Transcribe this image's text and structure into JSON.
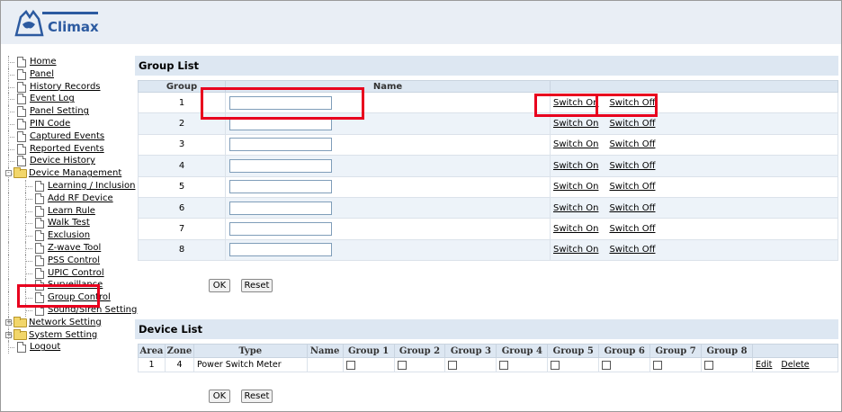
{
  "brand": {
    "logo_text": "Climax"
  },
  "sidebar": {
    "items": [
      {
        "label": "Home",
        "level": 0,
        "icon": "doc"
      },
      {
        "label": "Panel",
        "level": 0,
        "icon": "doc"
      },
      {
        "label": "History Records",
        "level": 0,
        "icon": "doc"
      },
      {
        "label": "Event Log",
        "level": 0,
        "icon": "doc"
      },
      {
        "label": "Panel Setting",
        "level": 0,
        "icon": "doc"
      },
      {
        "label": "PIN Code",
        "level": 0,
        "icon": "doc"
      },
      {
        "label": "Captured Events",
        "level": 0,
        "icon": "doc"
      },
      {
        "label": "Reported Events",
        "level": 0,
        "icon": "doc"
      },
      {
        "label": "Device History",
        "level": 0,
        "icon": "doc"
      },
      {
        "label": "Device Management",
        "level": 0,
        "icon": "folder",
        "toggle": "-"
      },
      {
        "label": "Learning / Inclusion",
        "level": 1,
        "icon": "doc"
      },
      {
        "label": "Add RF Device",
        "level": 1,
        "icon": "doc"
      },
      {
        "label": "Learn Rule",
        "level": 1,
        "icon": "doc"
      },
      {
        "label": "Walk Test",
        "level": 1,
        "icon": "doc"
      },
      {
        "label": "Exclusion",
        "level": 1,
        "icon": "doc"
      },
      {
        "label": "Z-wave Tool",
        "level": 1,
        "icon": "doc"
      },
      {
        "label": "PSS Control",
        "level": 1,
        "icon": "doc"
      },
      {
        "label": "UPIC Control",
        "level": 1,
        "icon": "doc"
      },
      {
        "label": "Surveillance",
        "level": 1,
        "icon": "doc"
      },
      {
        "label": "Group Control",
        "level": 1,
        "icon": "doc"
      },
      {
        "label": "Sound/Siren Setting",
        "level": 1,
        "icon": "doc"
      },
      {
        "label": "Network Setting",
        "level": 0,
        "icon": "folder",
        "toggle": "+"
      },
      {
        "label": "System Setting",
        "level": 0,
        "icon": "folder",
        "toggle": "+"
      },
      {
        "label": "Logout",
        "level": 0,
        "icon": "doc"
      }
    ]
  },
  "group_list": {
    "title": "Group List",
    "headers": [
      "Group",
      "Name",
      ""
    ],
    "rows": [
      {
        "group": "1",
        "name": "",
        "switch_on": "Switch On",
        "switch_off": "Switch Off"
      },
      {
        "group": "2",
        "name": "",
        "switch_on": "Switch On",
        "switch_off": "Switch Off"
      },
      {
        "group": "3",
        "name": "",
        "switch_on": "Switch On",
        "switch_off": "Switch Off"
      },
      {
        "group": "4",
        "name": "",
        "switch_on": "Switch On",
        "switch_off": "Switch Off"
      },
      {
        "group": "5",
        "name": "",
        "switch_on": "Switch On",
        "switch_off": "Switch Off"
      },
      {
        "group": "6",
        "name": "",
        "switch_on": "Switch On",
        "switch_off": "Switch Off"
      },
      {
        "group": "7",
        "name": "",
        "switch_on": "Switch On",
        "switch_off": "Switch Off"
      },
      {
        "group": "8",
        "name": "",
        "switch_on": "Switch On",
        "switch_off": "Switch Off"
      }
    ],
    "ok_label": "OK",
    "reset_label": "Reset"
  },
  "device_list": {
    "title": "Device List",
    "headers": [
      "Area",
      "Zone",
      "Type",
      "Name",
      "Group 1",
      "Group 2",
      "Group 3",
      "Group 4",
      "Group 5",
      "Group 6",
      "Group 7",
      "Group 8",
      ""
    ],
    "rows": [
      {
        "area": "1",
        "zone": "4",
        "type": "Power Switch Meter",
        "name": "",
        "groups": [
          false,
          false,
          false,
          false,
          false,
          false,
          false,
          false
        ],
        "edit": "Edit",
        "delete": "Delete"
      }
    ],
    "ok_label": "OK",
    "reset_label": "Reset"
  },
  "colors": {
    "highlight": "#e8001e",
    "header_bg": "#e9eef5",
    "section_bg": "#dde7f2",
    "row_alt": "#edf3f9",
    "logo_blue": "#2c5aa0"
  }
}
